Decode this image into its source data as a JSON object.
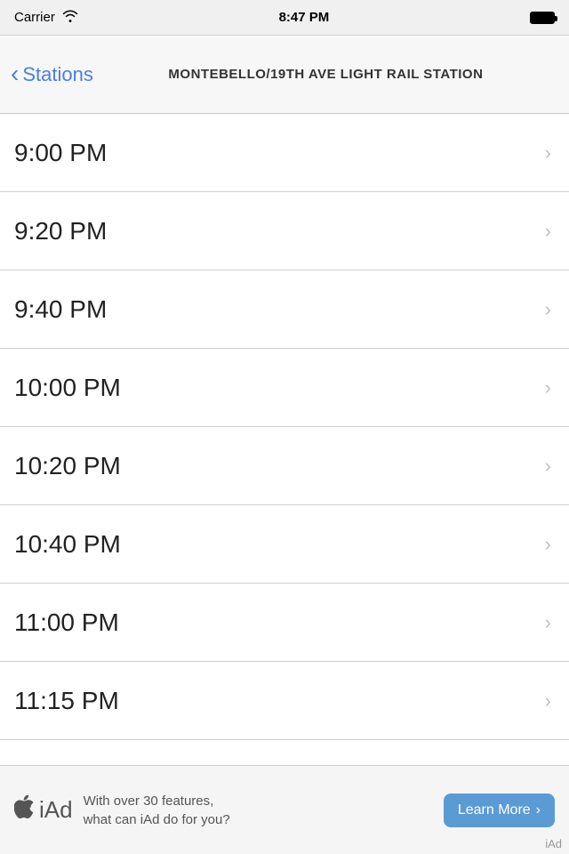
{
  "statusBar": {
    "carrier": "Carrier",
    "time": "8:47 PM"
  },
  "navBar": {
    "backLabel": "Stations",
    "title": "MONTEBELLO/19TH AVE LIGHT RAIL STATION"
  },
  "schedule": {
    "items": [
      {
        "time": "9:00 PM"
      },
      {
        "time": "9:20 PM"
      },
      {
        "time": "9:40 PM"
      },
      {
        "time": "10:00 PM"
      },
      {
        "time": "10:20 PM"
      },
      {
        "time": "10:40 PM"
      },
      {
        "time": "11:00 PM"
      },
      {
        "time": "11:15 PM"
      }
    ]
  },
  "adBanner": {
    "logoText": "iAd",
    "copyLine1": "With over 30 features,",
    "copyLine2": "what can iAd do for you?",
    "learnMoreLabel": "Learn More",
    "adLabel": "iAd"
  }
}
